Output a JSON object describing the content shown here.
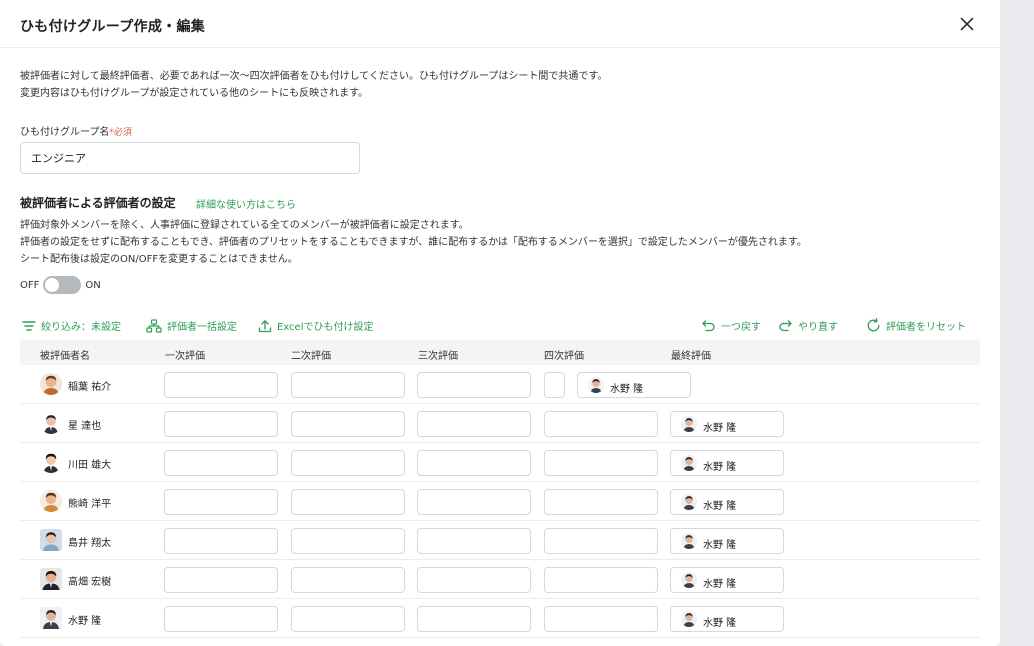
{
  "modal": {
    "title": "ひも付けグループ作成・編集",
    "description": [
      "被評価者に対して最終評価者、必要であれば一次〜四次評価者をひも付けしてください。ひも付けグループはシート間で共通です。",
      "変更内容はひも付けグループが設定されている他のシートにも反映されます。"
    ]
  },
  "group_name": {
    "label": "ひも付けグループ名",
    "required": "*必須",
    "value": "エンジニア"
  },
  "evaluator_section": {
    "title": "被評価者による評価者の設定",
    "help_link": "詳細な使い方はこちら",
    "notes": [
      "評価対象外メンバーを除く、人事評価に登録されている全てのメンバーが被評価者に設定されます。",
      "評価者の設定をせずに配布することもでき、評価者のプリセットをすることもできますが、誰に配布するかは「配布するメンバーを選択」で設定したメンバーが優先されます。",
      "シート配布後は設定のON/OFFを変更することはできません。"
    ],
    "toggle_off": "OFF",
    "toggle_on": "ON"
  },
  "toolbar": {
    "filter": "絞り込み：未設定",
    "bulk": "評価者一括設定",
    "excel": "Excelでひも付け設定",
    "undo": "一つ戻す",
    "redo": "やり直す",
    "reset": "評価者をリセット"
  },
  "table": {
    "headers": [
      "被評価者名",
      "一次評価",
      "二次評価",
      "三次評価",
      "四次評価",
      "最終評価"
    ],
    "rows": [
      {
        "name": "稲葉 祐介",
        "final": "水野 隆"
      },
      {
        "name": "星 達也",
        "final": "水野 隆"
      },
      {
        "name": "川田 雄大",
        "final": "水野 隆"
      },
      {
        "name": "熊崎 洋平",
        "final": "水野 隆"
      },
      {
        "name": "島井 翔太",
        "final": "水野 隆"
      },
      {
        "name": "高畑 宏樹",
        "final": "水野 隆"
      },
      {
        "name": "水野 隆",
        "final": "水野 隆"
      }
    ]
  },
  "colors": {
    "accent": "#2e9d55",
    "required": "#e15a48",
    "toggle_off": "#b5b8bc"
  }
}
